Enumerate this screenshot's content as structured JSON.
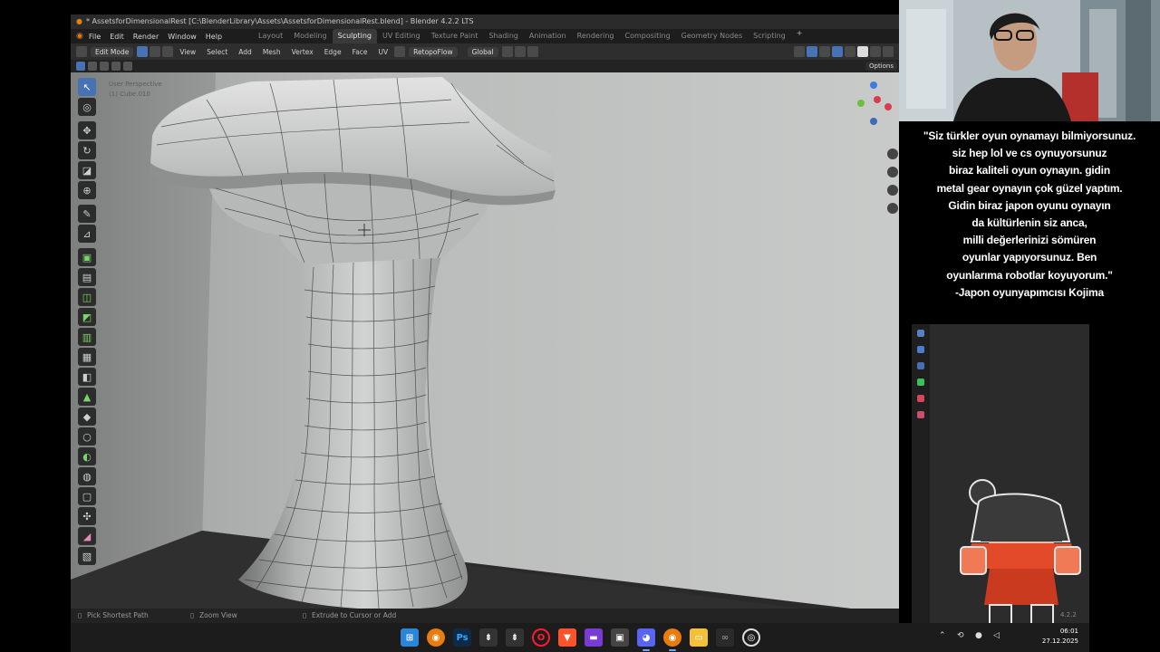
{
  "window": {
    "title": "* AssetsforDimensionalRest [C:\\BlenderLibrary\\Assets\\AssetsforDimensionalRest.blend] - Blender 4.2.2 LTS"
  },
  "menu": [
    "File",
    "Edit",
    "Render",
    "Window",
    "Help"
  ],
  "workspaces": [
    {
      "label": "Layout",
      "active": false
    },
    {
      "label": "Modeling",
      "active": false
    },
    {
      "label": "Sculpting",
      "active": true
    },
    {
      "label": "UV Editing",
      "active": false
    },
    {
      "label": "Texture Paint",
      "active": false
    },
    {
      "label": "Shading",
      "active": false
    },
    {
      "label": "Animation",
      "active": false
    },
    {
      "label": "Rendering",
      "active": false
    },
    {
      "label": "Compositing",
      "active": false
    },
    {
      "label": "Geometry Nodes",
      "active": false
    },
    {
      "label": "Scripting",
      "active": false
    }
  ],
  "workspace_add": "+",
  "header": {
    "mode": "Edit Mode",
    "items": [
      "View",
      "Select",
      "Add",
      "Mesh",
      "Vertex",
      "Edge",
      "Face",
      "UV"
    ],
    "addon": "RetopoFlow",
    "orientation": "Global",
    "options": "Options"
  },
  "viewport": {
    "perspective": "User Perspective",
    "object": "(1) Cube.010"
  },
  "status": {
    "left": "Pick Shortest Path",
    "middle": "Zoom View",
    "right": "Extrude to Cursor or Add"
  },
  "quote_lines": [
    "\"Siz türkler oyun oynamayı bilmiyorsunuz.",
    "siz hep lol ve cs oynuyorsunuz",
    "biraz kaliteli oyun oynayın. gidin",
    "metal gear oynayın çok güzel yaptım.",
    "Gidin biraz japon oyunu oynayın",
    "da kültürlenin siz anca,",
    "milli değerlerinizi sömüren",
    "oyunlar yapıyorsunuz. Ben",
    "oyunlarıma robotlar koyuyorum.\"",
    "-Japon oyunyapımcısı Kojima"
  ],
  "version_badge": "4.2.2",
  "clock": {
    "time": "06:01",
    "date": "27.12.2025"
  },
  "taskbar_icons": [
    "windows-icon",
    "blender-icon",
    "photoshop-icon",
    "app-icon",
    "app-icon-2",
    "opera-icon",
    "brave-icon",
    "video-editor-icon",
    "media-icon",
    "discord-icon",
    "blender-icon-2",
    "explorer-icon",
    "app-icon-3",
    "obs-icon"
  ],
  "colors": {
    "accent_blue": "#4772b3",
    "blender_orange": "#e87d0d",
    "viewport_wall": "#b8bab9",
    "taskbar": "#1c1c1c"
  }
}
